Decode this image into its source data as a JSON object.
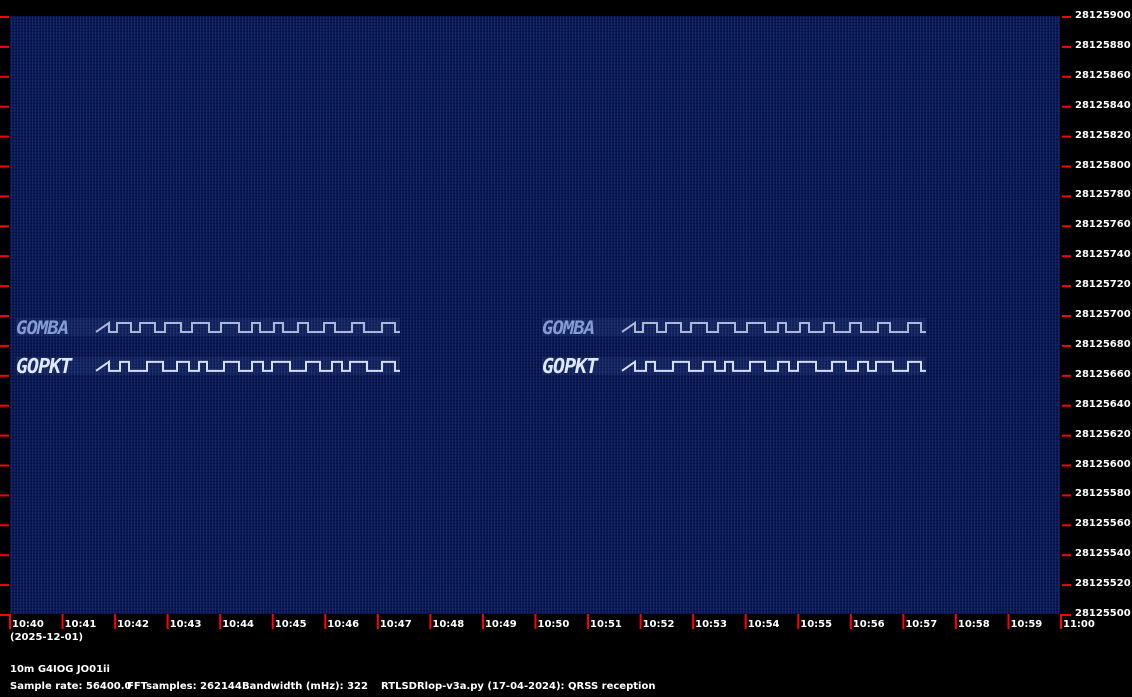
{
  "frequency_ticks": [
    "28125900",
    "28125880",
    "28125860",
    "28125840",
    "28125820",
    "28125800",
    "28125780",
    "28125760",
    "28125740",
    "28125720",
    "28125700",
    "28125680",
    "28125660",
    "28125640",
    "28125620",
    "28125600",
    "28125580",
    "28125560",
    "28125540",
    "28125520",
    "28125500"
  ],
  "time_ticks": [
    "10:40",
    "10:41",
    "10:42",
    "10:43",
    "10:44",
    "10:45",
    "10:46",
    "10:47",
    "10:48",
    "10:49",
    "10:50",
    "10:51",
    "10:52",
    "10:53",
    "10:54",
    "10:55",
    "10:56",
    "10:57",
    "10:58",
    "10:59",
    "11:00"
  ],
  "date_label": "(2025-12-01)",
  "station_label": "10m G4IOG JO01ii",
  "sample_rate": "Sample rate: 56400.0",
  "fft_samples": "FFTsamples: 262144",
  "bandwidth": "Bandwidth (mHz): 322",
  "software": "RTLSDRlop-v3a.py (17-04-2024): QRSS reception",
  "signals": [
    {
      "callsign": "GOMBA",
      "freq": 28125692
    },
    {
      "callsign": "GOPKT",
      "freq": 28125666
    }
  ],
  "colors": {
    "background": "#000000",
    "waterfall": "#0b1f5c",
    "tick": "#ff0000",
    "signal": "#dfe8ff"
  }
}
